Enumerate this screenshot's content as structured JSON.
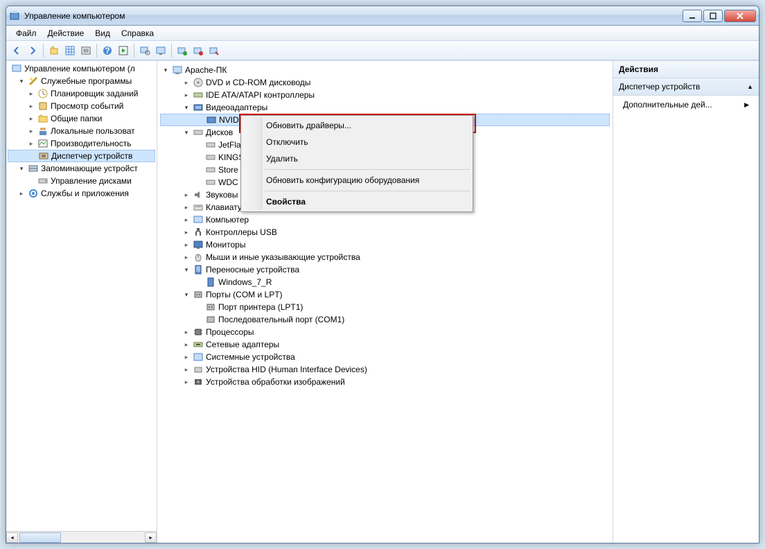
{
  "window": {
    "title": "Управление компьютером"
  },
  "menubar": [
    "Файл",
    "Действие",
    "Вид",
    "Справка"
  ],
  "left_tree": {
    "root": "Управление компьютером (л",
    "groups": [
      {
        "label": "Служебные программы",
        "children": [
          "Планировщик заданий",
          "Просмотр событий",
          "Общие папки",
          "Локальные пользоват",
          "Производительность",
          "Диспетчер устройств"
        ]
      },
      {
        "label": "Запоминающие устройст",
        "children": [
          "Управление дисками"
        ]
      },
      {
        "label": "Службы и приложения",
        "children": []
      }
    ]
  },
  "device_tree": {
    "root": "Apache-ПК",
    "items": [
      {
        "label": "DVD и CD-ROM дисководы",
        "expanded": false,
        "depth": 1
      },
      {
        "label": "IDE ATA/ATAPI контроллеры",
        "expanded": false,
        "depth": 1
      },
      {
        "label": "Видеоадаптеры",
        "expanded": true,
        "depth": 1
      },
      {
        "label": "NVID",
        "expanded": null,
        "depth": 2,
        "selected": true
      },
      {
        "label": "Дисков",
        "expanded": true,
        "depth": 1
      },
      {
        "label": "JetFla",
        "expanded": null,
        "depth": 2
      },
      {
        "label": "KINGS",
        "expanded": null,
        "depth": 2
      },
      {
        "label": "Store",
        "expanded": null,
        "depth": 2
      },
      {
        "label": "WDC",
        "expanded": null,
        "depth": 2
      },
      {
        "label": "Звуковы",
        "expanded": false,
        "depth": 1
      },
      {
        "label": "Клавиатуры",
        "expanded": false,
        "depth": 1
      },
      {
        "label": "Компьютер",
        "expanded": false,
        "depth": 1
      },
      {
        "label": "Контроллеры USB",
        "expanded": false,
        "depth": 1
      },
      {
        "label": "Мониторы",
        "expanded": false,
        "depth": 1
      },
      {
        "label": "Мыши и иные указывающие устройства",
        "expanded": false,
        "depth": 1
      },
      {
        "label": "Переносные устройства",
        "expanded": true,
        "depth": 1
      },
      {
        "label": "Windows_7_R",
        "expanded": null,
        "depth": 2
      },
      {
        "label": "Порты (COM и LPT)",
        "expanded": true,
        "depth": 1
      },
      {
        "label": "Порт принтера (LPT1)",
        "expanded": null,
        "depth": 2
      },
      {
        "label": "Последовательный порт (COM1)",
        "expanded": null,
        "depth": 2
      },
      {
        "label": "Процессоры",
        "expanded": false,
        "depth": 1
      },
      {
        "label": "Сетевые адаптеры",
        "expanded": false,
        "depth": 1
      },
      {
        "label": "Системные устройства",
        "expanded": false,
        "depth": 1
      },
      {
        "label": "Устройства HID (Human Interface Devices)",
        "expanded": false,
        "depth": 1
      },
      {
        "label": "Устройства обработки изображений",
        "expanded": false,
        "depth": 1
      }
    ]
  },
  "context_menu": {
    "items": [
      {
        "label": "Обновить драйверы...",
        "type": "item"
      },
      {
        "label": "Отключить",
        "type": "item"
      },
      {
        "label": "Удалить",
        "type": "item"
      },
      {
        "type": "sep"
      },
      {
        "label": "Обновить конфигурацию оборудования",
        "type": "item"
      },
      {
        "type": "sep"
      },
      {
        "label": "Свойства",
        "type": "item",
        "bold": true
      }
    ]
  },
  "actions": {
    "header": "Действия",
    "sub": "Диспетчер устройств",
    "more": "Дополнительные дей..."
  }
}
